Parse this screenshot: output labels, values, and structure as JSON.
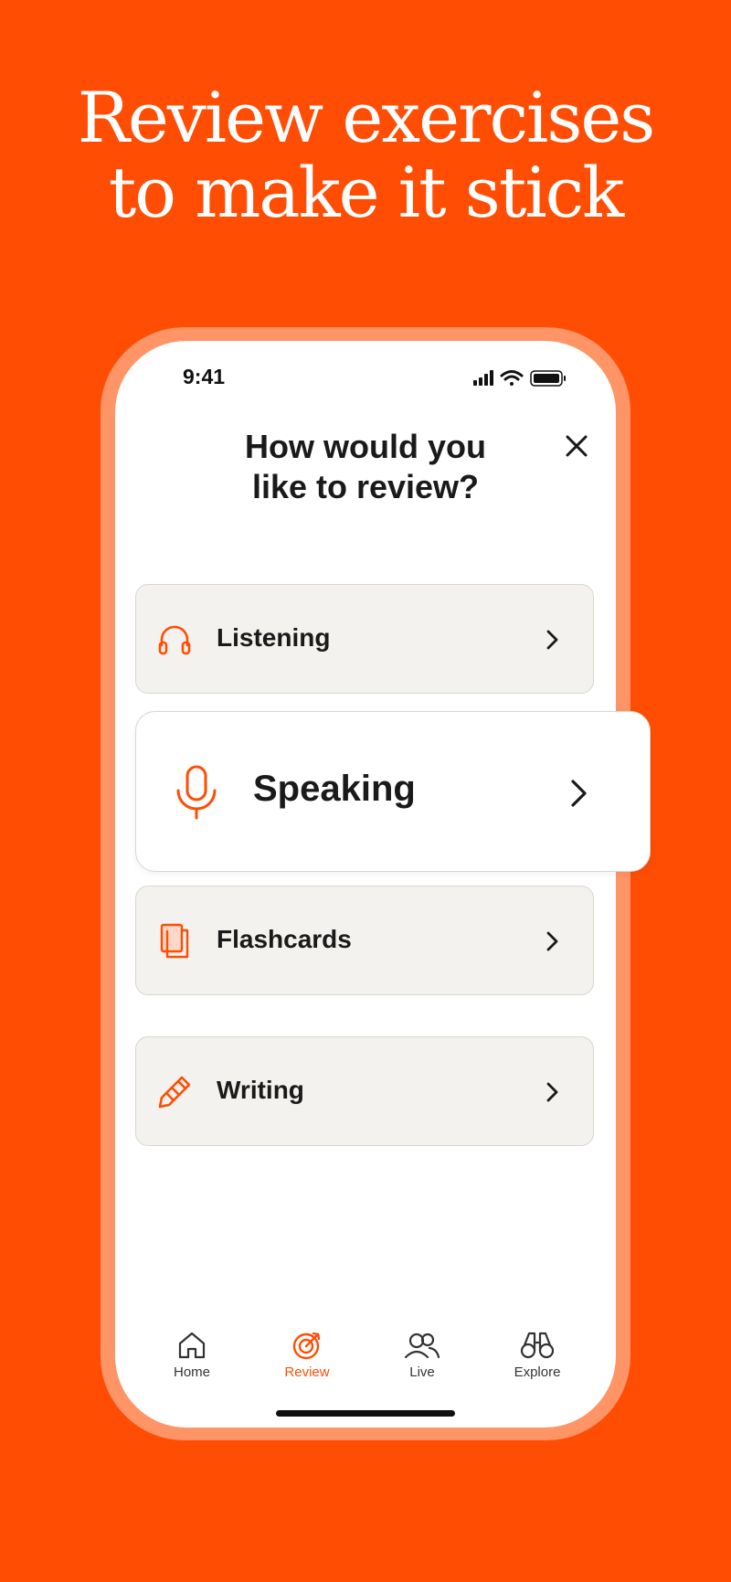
{
  "headline": {
    "line1": "Review exercises",
    "line2": "to make it stick"
  },
  "colors": {
    "brand": "#FF4D04",
    "frame": "#FF9466",
    "card_bg": "#F4F2EE",
    "card_border": "#D9D6CF"
  },
  "status_bar": {
    "time": "9:41",
    "icons": [
      "cellular-signal-icon",
      "wifi-icon",
      "battery-icon"
    ]
  },
  "screen": {
    "title_line1": "How would you",
    "title_line2": "like to review?",
    "close_icon": "close-icon"
  },
  "options": [
    {
      "label": "Listening",
      "icon": "headphones-icon"
    },
    {
      "label": "Speaking",
      "icon": "microphone-icon",
      "highlighted": true
    },
    {
      "label": "Flashcards",
      "icon": "flashcards-icon"
    },
    {
      "label": "Writing",
      "icon": "pencil-icon"
    }
  ],
  "nav": [
    {
      "label": "Home",
      "icon": "home-icon"
    },
    {
      "label": "Review",
      "icon": "target-icon",
      "active": true
    },
    {
      "label": "Live",
      "icon": "people-icon"
    },
    {
      "label": "Explore",
      "icon": "binoculars-icon"
    }
  ]
}
